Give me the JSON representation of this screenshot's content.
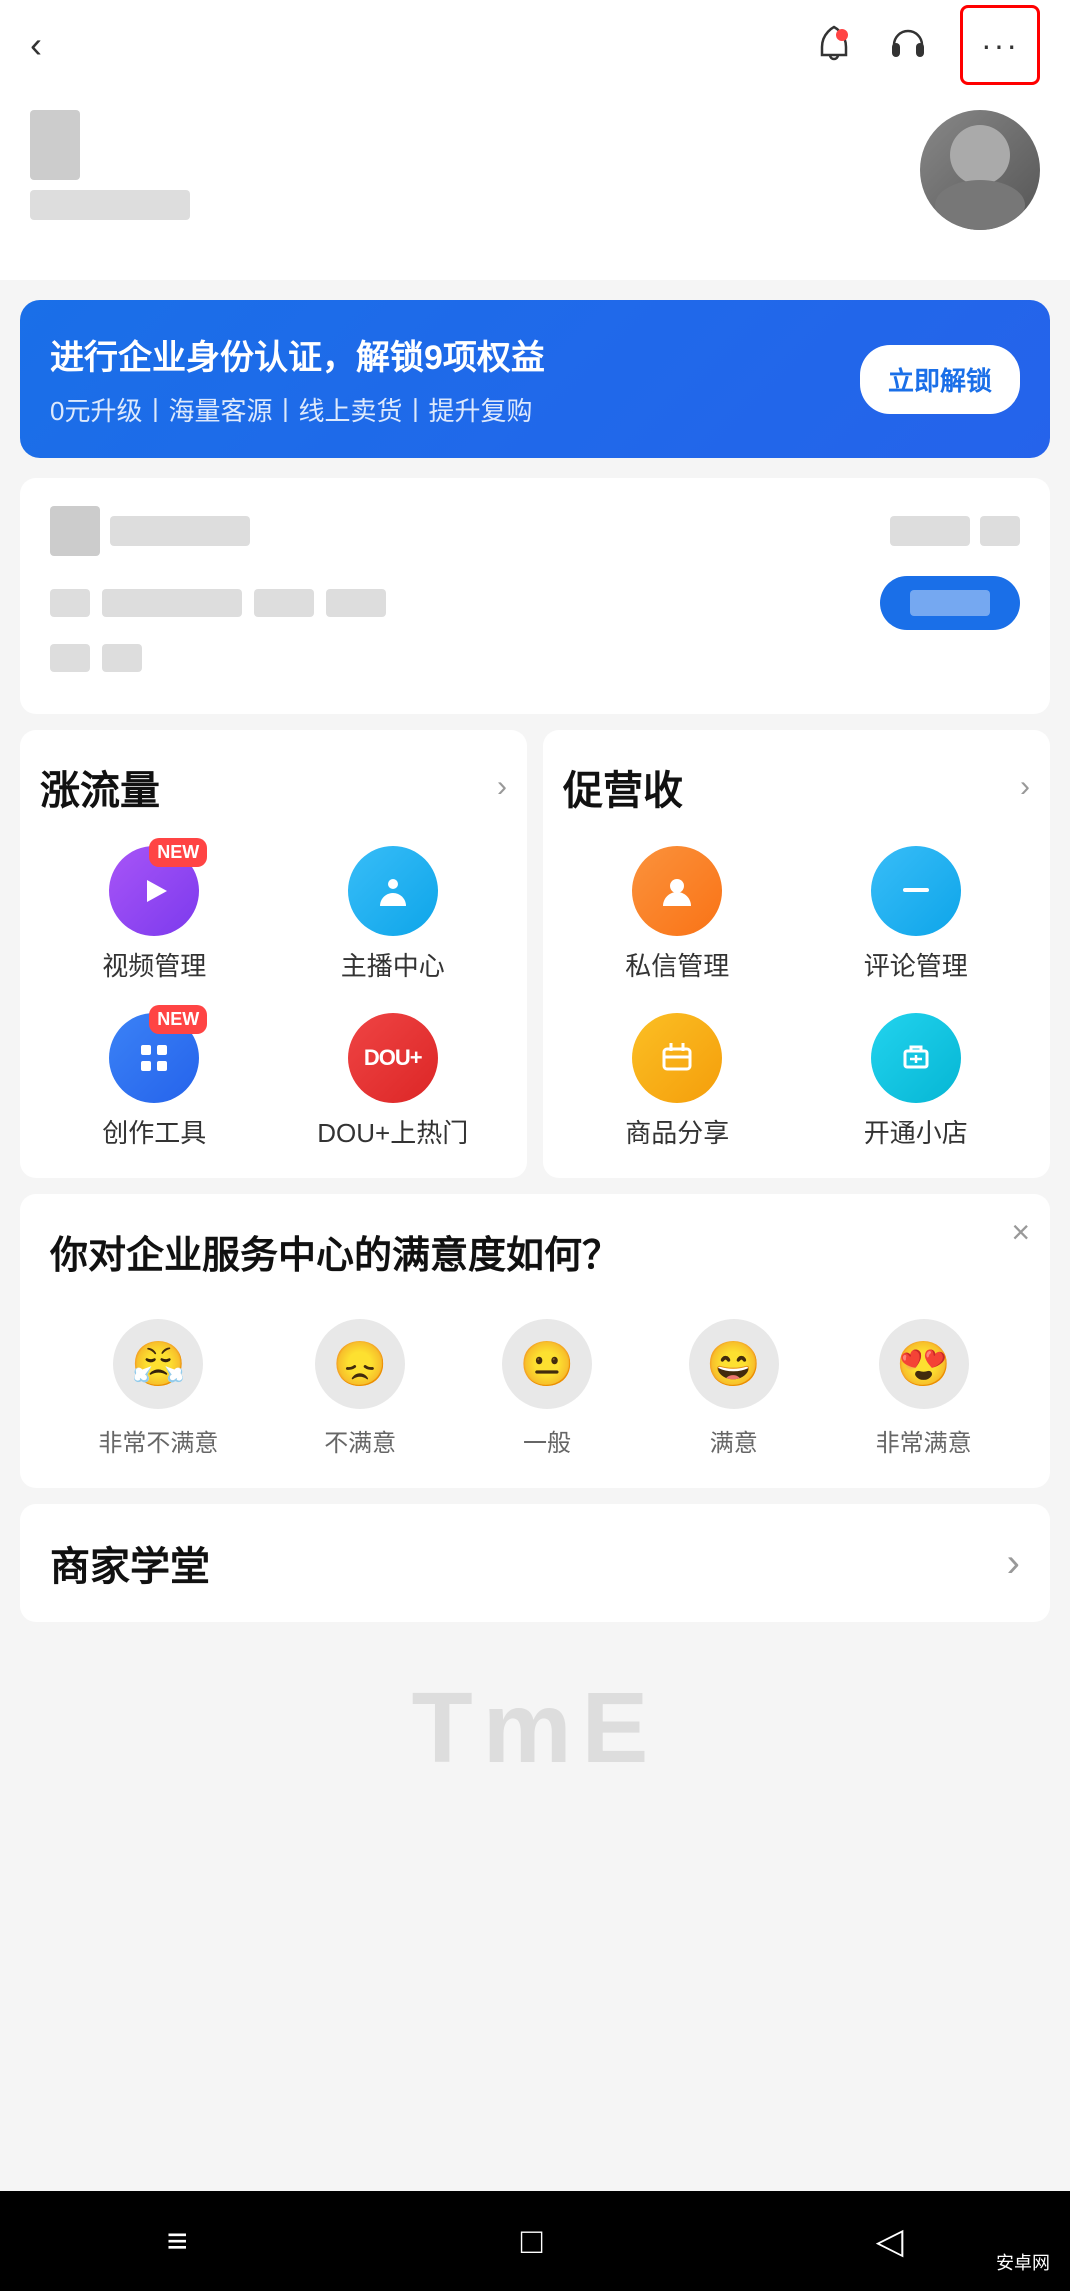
{
  "nav": {
    "back_label": "‹",
    "notification_icon": "🔔",
    "headset_icon": "🎧",
    "more_label": "···"
  },
  "promo_banner": {
    "title": "进行企业身份认证，解锁9项权益",
    "subtitle": "0元升级丨海量客源丨线上卖货丨提升复购",
    "button_label": "立即解锁"
  },
  "features": {
    "left_card": {
      "title": "涨流量",
      "items": [
        {
          "id": "video",
          "label": "视频管理",
          "has_new": true,
          "icon": "▶"
        },
        {
          "id": "anchor",
          "label": "主播中心",
          "has_new": false,
          "icon": "💬"
        },
        {
          "id": "create",
          "label": "创作工具",
          "has_new": true,
          "icon": "↗"
        },
        {
          "id": "dou",
          "label": "DOU+上热门",
          "has_new": false,
          "icon": "DOU+"
        }
      ]
    },
    "right_card": {
      "title": "促营收",
      "items": [
        {
          "id": "dm",
          "label": "私信管理",
          "has_new": false,
          "icon": "👤"
        },
        {
          "id": "comment",
          "label": "评论管理",
          "has_new": false,
          "icon": "—"
        },
        {
          "id": "share",
          "label": "商品分享",
          "has_new": false,
          "icon": "✉"
        },
        {
          "id": "shop",
          "label": "开通小店",
          "has_new": false,
          "icon": "曲"
        }
      ]
    }
  },
  "survey": {
    "title": "你对企业服务中心的满意度如何？",
    "close_label": "×",
    "options": [
      {
        "id": "very_bad",
        "emoji": "😤",
        "label": "非常不满意"
      },
      {
        "id": "bad",
        "emoji": "😞",
        "label": "不满意"
      },
      {
        "id": "normal",
        "emoji": "😐",
        "label": "一般"
      },
      {
        "id": "good",
        "emoji": "😄",
        "label": "满意"
      },
      {
        "id": "very_good",
        "emoji": "😍",
        "label": "非常满意"
      }
    ]
  },
  "academy": {
    "title": "商家学堂",
    "more_label": "›"
  },
  "tme": {
    "text": "TmE"
  },
  "bottom_nav": {
    "menu_icon": "≡",
    "home_icon": "□",
    "back_icon": "◁"
  }
}
